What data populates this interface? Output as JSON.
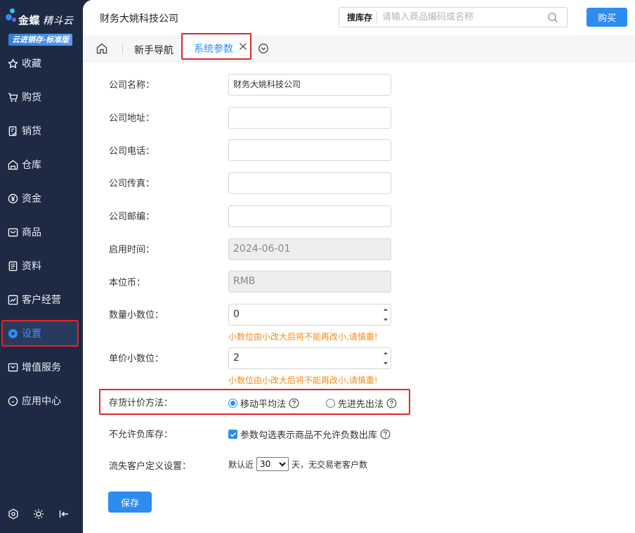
{
  "brand": {
    "name": "金蝶",
    "product": "精斗云",
    "edition": "云进销存·标准版",
    "dot_colors": [
      "#2d8cf0",
      "#36c0e8",
      "#7b5cf0"
    ]
  },
  "sidebar": {
    "items": [
      {
        "label": "收藏",
        "icon": "star-icon"
      },
      {
        "label": "购货",
        "icon": "cart-icon"
      },
      {
        "label": "销货",
        "icon": "sales-doc-icon"
      },
      {
        "label": "仓库",
        "icon": "warehouse-icon"
      },
      {
        "label": "资金",
        "icon": "yen-icon"
      },
      {
        "label": "商品",
        "icon": "goods-icon"
      },
      {
        "label": "资料",
        "icon": "document-icon"
      },
      {
        "label": "客户经营",
        "icon": "chart-icon"
      },
      {
        "label": "设置",
        "icon": "settings-icon",
        "active": true
      },
      {
        "label": "增值服务",
        "icon": "service-icon"
      },
      {
        "label": "应用中心",
        "icon": "app-center-icon"
      }
    ],
    "bottom_icons": [
      "gear-icon",
      "sun-icon",
      "collapse-icon"
    ]
  },
  "header": {
    "company": "财务大姚科技公司",
    "search_type": "搜库存",
    "search_placeholder": "请输入商品编码或名称",
    "buy_label": "购买"
  },
  "tabs": {
    "guide": "新手导航",
    "active": "系统参数"
  },
  "form": {
    "company_name": {
      "label": "公司名称：",
      "value": "财务大姚科技公司"
    },
    "company_address": {
      "label": "公司地址：",
      "value": ""
    },
    "company_phone": {
      "label": "公司电话：",
      "value": ""
    },
    "company_fax": {
      "label": "公司传真：",
      "value": ""
    },
    "company_postcode": {
      "label": "公司邮编：",
      "value": ""
    },
    "start_date": {
      "label": "启用时间：",
      "value": "2024-06-01"
    },
    "base_currency": {
      "label": "本位币：",
      "value": "RMB"
    },
    "qty_decimals": {
      "label": "数量小数位：",
      "value": "0",
      "hint": "小数位由小改大后将不能再改小,请慎重!"
    },
    "price_decimals": {
      "label": "单价小数位：",
      "value": "2",
      "hint": "小数位由小改大后将不能再改小,请慎重!"
    },
    "costing_method": {
      "label": "存货计价方法：",
      "option_moving": "移动平均法",
      "option_fifo": "先进先出法",
      "selected": "移动平均法"
    },
    "negative_stock": {
      "label": "不允许负库存：",
      "checkbox_text": "参数勾选表示商品不允许负数出库",
      "checked": true
    },
    "lost_customer": {
      "label": "流失客户定义设置：",
      "prefix": "默认近",
      "days": "30",
      "suffix": "天，无交易老客户数"
    },
    "save_label": "保存"
  }
}
